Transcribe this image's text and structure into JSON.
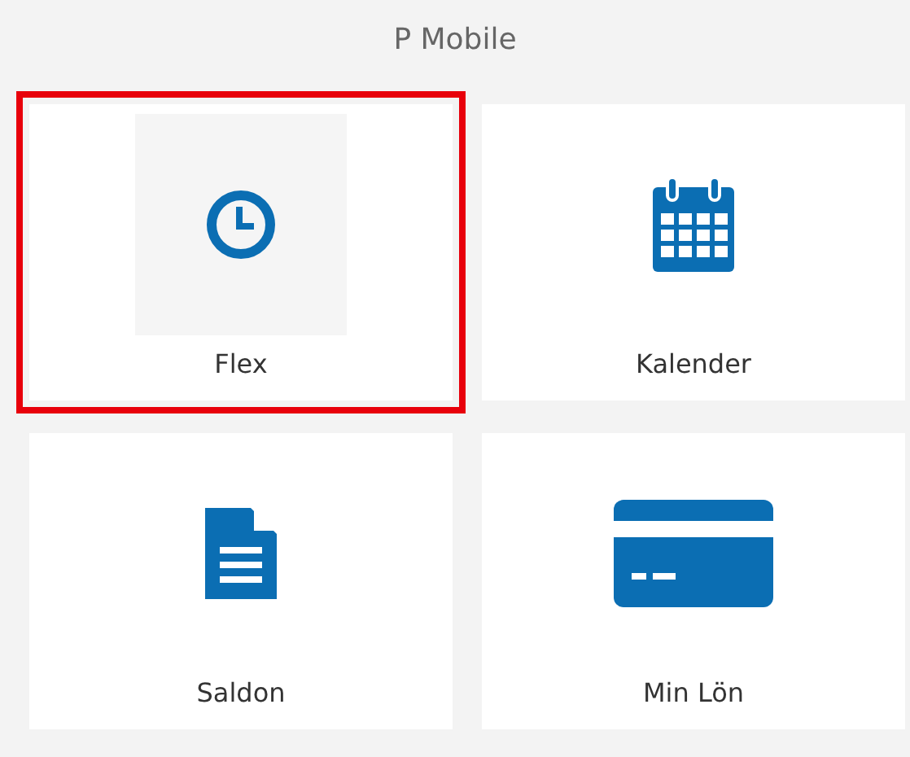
{
  "header": {
    "title": "P Mobile"
  },
  "tiles": [
    {
      "label": "Flex",
      "kind": "clock",
      "selected": true
    },
    {
      "label": "Kalender",
      "kind": "calendar",
      "selected": false
    },
    {
      "label": "Saldon",
      "kind": "document",
      "selected": false
    },
    {
      "label": "Min Lön",
      "kind": "card",
      "selected": false
    }
  ]
}
